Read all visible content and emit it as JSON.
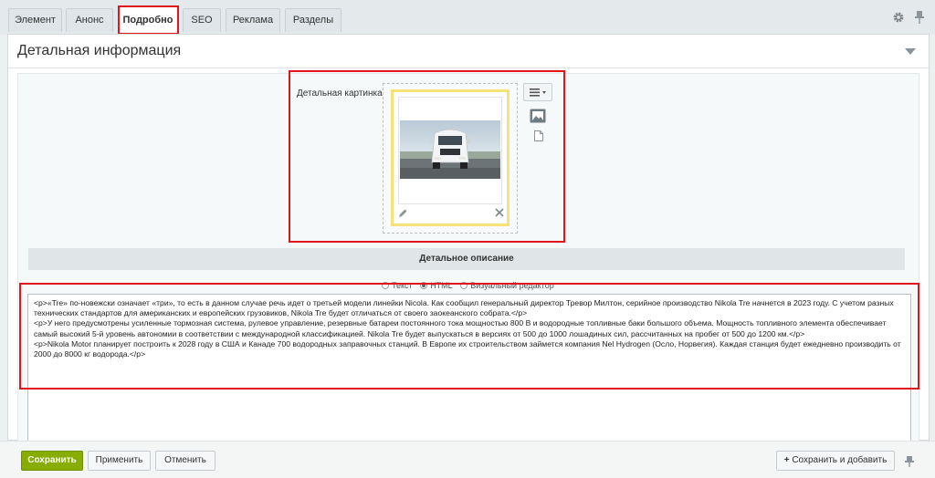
{
  "tabs": [
    {
      "label": "Элемент"
    },
    {
      "label": "Анонс"
    },
    {
      "label": "Подробно",
      "active": true
    },
    {
      "label": "SEO"
    },
    {
      "label": "Реклама"
    },
    {
      "label": "Разделы"
    }
  ],
  "tab_icons": [
    "gear-icon",
    "pin-icon"
  ],
  "panel": {
    "title": "Детальная информация"
  },
  "picture": {
    "label": "Детальная картинка:",
    "image_desc_icon": "truck-photo",
    "controls": [
      "menu-icon",
      "image-mode-icon",
      "file-mode-icon",
      "edit-icon",
      "delete-icon"
    ]
  },
  "description": {
    "section_title": "Детальное описание",
    "modes": [
      {
        "label": "Текст",
        "checked": false
      },
      {
        "label": "HTML",
        "checked": true
      },
      {
        "label": "Визуальный редактор",
        "checked": false
      }
    ],
    "paragraphs": [
      "<p>«Tre» по-новежски означает «три», то есть в данном случае речь идет о третьей модели линейки Nicola. Как сообщил генеральный директор Тревор Милтон, серийное производство Nikola Tre начнется в 2023 году. С учетом разных технических стандартов для американских и европейских грузовиков, Nikola Tre будет отличаться от своего заокеанского собрата.</p>",
      "<p>У него предусмотрены усиленные тормозная система, рулевое управление, резервные батареи постоянного тока мощностью 800 В и водородные топливные баки большого объема. Мощность топливного элемента обеспечивает самый высокий 5-й уровень автономии в соответствии с международной классификацией. Nikola Tre будет выпускаться в версиях от 500 до 1000 лошадиных сил, рассчитанных на пробег от 500 до 1200 км.</p>",
      "<p>Nikola Motor планирует построить к 2028 году в США и Канаде 700 водородных заправочных станций. В Европе их строительством займется компания Nel Hydrogen (Осло, Норвегия). Каждая станция будет ежедневно производить от 2000 до 8000 кг водорода.</p>"
    ]
  },
  "buttons": {
    "save": "Сохранить",
    "apply": "Применить",
    "cancel": "Отменить",
    "save_add": "Сохранить и добавить"
  },
  "colors": {
    "highlight": "#e0161c",
    "primary": "#86ad00",
    "picture_frame": "#f7e27a"
  }
}
